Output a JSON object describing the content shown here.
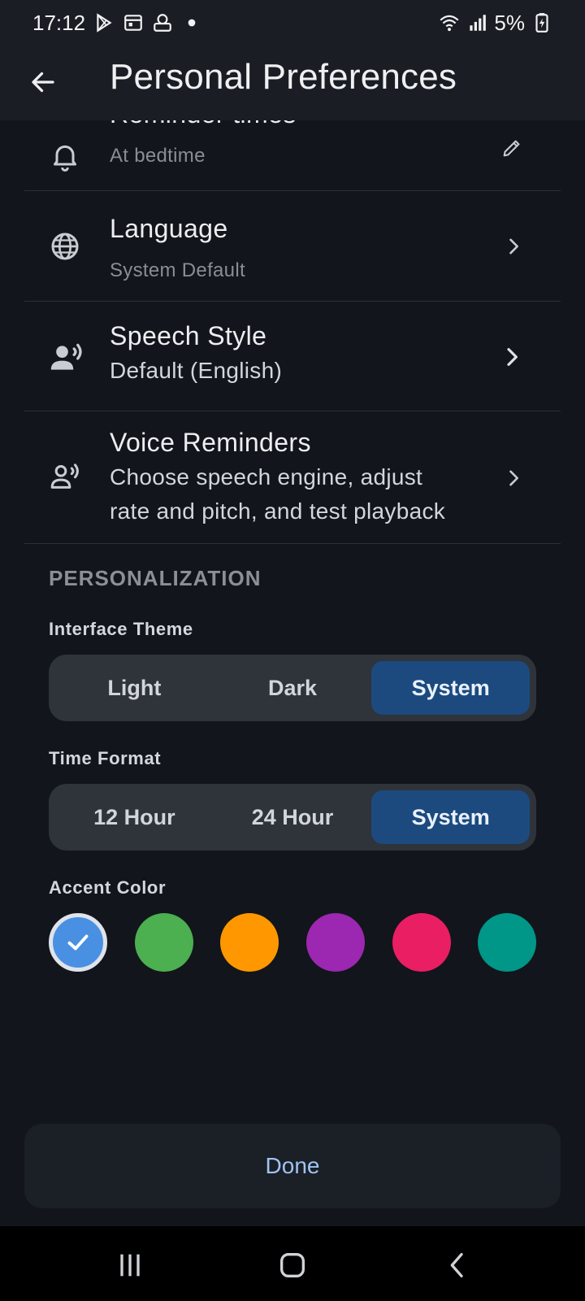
{
  "status_bar": {
    "time": "17:12",
    "battery": "5%",
    "left_icons": [
      "play-store-icon",
      "calendar-icon",
      "app-notification-icon",
      "dot-icon"
    ],
    "right_icons": [
      "wifi-icon",
      "signal-icon",
      "battery-charging-icon"
    ]
  },
  "app_bar": {
    "title": "Personal Preferences",
    "back_icon": "arrow-left-icon"
  },
  "settings": {
    "reminder": {
      "title": "Reminder times",
      "subtitle": "At bedtime",
      "icon": "bell-icon",
      "action_icon": "pencil-icon"
    },
    "language": {
      "title": "Language",
      "subtitle": "System Default",
      "icon": "globe-icon",
      "action_icon": "chevron-right-icon"
    },
    "speech_style": {
      "title": "Speech Style",
      "subtitle": "Default (English)",
      "icon": "person-voice-icon",
      "action_icon": "chevron-right-icon"
    },
    "voice_reminders": {
      "title": "Voice Reminders",
      "subtitle_line1": "Choose speech engine, adjust",
      "subtitle_line2": "rate and pitch, and test playback",
      "icon": "person-voice-outline-icon",
      "action_icon": "chevron-right-icon"
    }
  },
  "personalization": {
    "header": "PERSONALIZATION",
    "theme": {
      "label": "Interface Theme",
      "options": [
        "Light",
        "Dark",
        "System"
      ],
      "selected": "System"
    },
    "time_format": {
      "label": "Time Format",
      "options": [
        "12 Hour",
        "24 Hour",
        "System"
      ],
      "selected": "System"
    },
    "accent": {
      "label": "Accent Color",
      "colors": [
        "#4a90e2",
        "#4caf50",
        "#ff9800",
        "#9c27b0",
        "#e91e63",
        "#009688"
      ],
      "selected_index": 0
    }
  },
  "done_label": "Done",
  "nav": [
    "recents-icon",
    "home-icon",
    "back-icon"
  ],
  "colors": {
    "background": "#12151b",
    "selected_segment": "#1c4a7e",
    "done_text": "#9fc3f2"
  }
}
